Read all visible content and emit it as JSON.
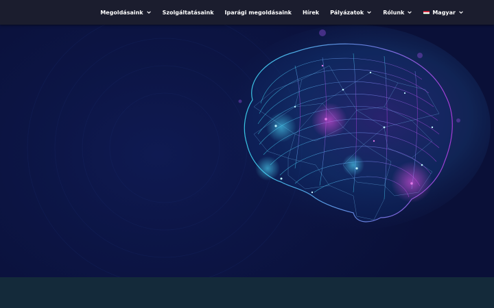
{
  "nav": {
    "items": [
      {
        "label": "Megoldásaink",
        "dropdown": true
      },
      {
        "label": "Szolgáltatásaink",
        "dropdown": false
      },
      {
        "label": "Iparági megoldásaink",
        "dropdown": false
      },
      {
        "label": "Hírek",
        "dropdown": false
      },
      {
        "label": "Pályázatok",
        "dropdown": true
      },
      {
        "label": "Rólunk",
        "dropdown": true
      }
    ],
    "language": {
      "label": "Magyar",
      "flag_icon": "hungary-flag-icon",
      "dropdown": true
    }
  },
  "hero": {
    "image_icon": "wireframe-brain-illustration"
  },
  "colors": {
    "navbar_bg": "#1b1d2e",
    "hero_bg": "#0c1545",
    "footer_bg": "#142a3a",
    "accent_cyan": "#39c8e6",
    "accent_purple": "#a63bd6"
  }
}
